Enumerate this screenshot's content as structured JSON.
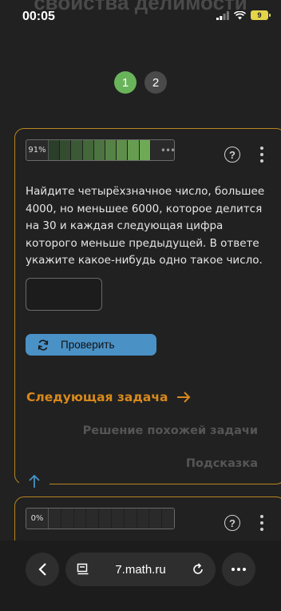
{
  "status_bar": {
    "time": "00:05",
    "battery": "9"
  },
  "header": {
    "title": "свойства делимости"
  },
  "pagination": {
    "pages": [
      "1",
      "2"
    ],
    "active_index": 0
  },
  "task_card": {
    "progress_label": "91%",
    "progress_fraction": 0.91,
    "progress_more": "•••",
    "problem_text": "Найдите четырёхзначное число, большее 4000, но меньшее 6000, которое делится на 30 и каждая следующая цифра которого меньше предыдущей. В ответе укажите какое-нибудь одно такое число.",
    "answer_value": "",
    "check_label": "Проверить",
    "next_label": "Следующая задача",
    "similar_label": "Решение похожей задачи",
    "hint_label": "Подсказка"
  },
  "task_card_2": {
    "progress_label": "0%",
    "progress_fraction": 0
  },
  "browser": {
    "url": "7.math.ru"
  },
  "colors": {
    "accent_orange": "#d9891c",
    "active_page_green": "#69b45a",
    "check_button_blue": "#4a91c6",
    "card_border": "#b78520"
  },
  "icons": [
    "help-icon",
    "kebab-icon",
    "refresh-icon",
    "arrow-right-icon",
    "arrow-up-icon",
    "chevron-left-icon",
    "reader-icon",
    "reload-icon",
    "more-icon"
  ]
}
